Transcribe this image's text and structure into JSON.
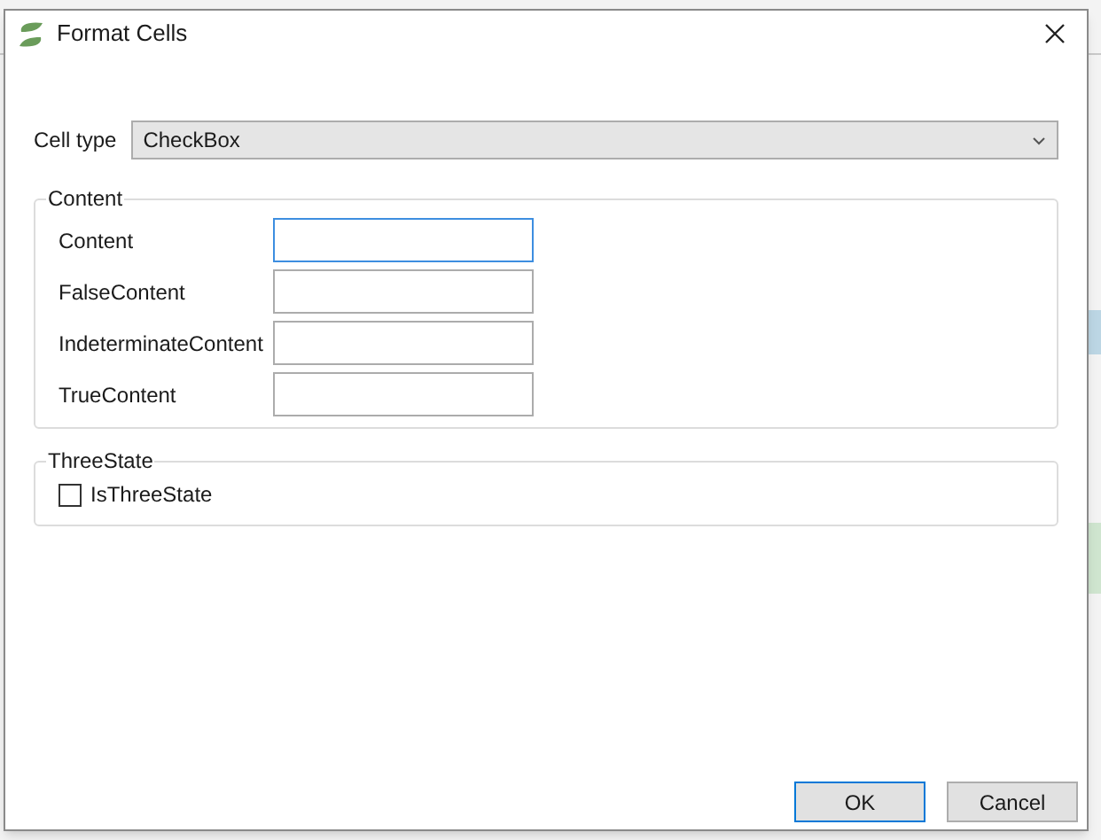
{
  "window": {
    "title": "Format Cells"
  },
  "cell_type": {
    "label": "Cell type",
    "value": "CheckBox"
  },
  "content_group": {
    "title": "Content",
    "fields": [
      {
        "label": "Content",
        "focused": true
      },
      {
        "label": "FalseContent",
        "focused": false
      },
      {
        "label": "IndeterminateContent",
        "focused": false
      },
      {
        "label": "TrueContent",
        "focused": false
      }
    ]
  },
  "three_state_group": {
    "title": "ThreeState",
    "checkbox": {
      "label": "IsThreeState",
      "checked": false
    }
  },
  "buttons": [
    {
      "label": "OK",
      "default": true
    },
    {
      "label": "Cancel",
      "default": false
    }
  ]
}
